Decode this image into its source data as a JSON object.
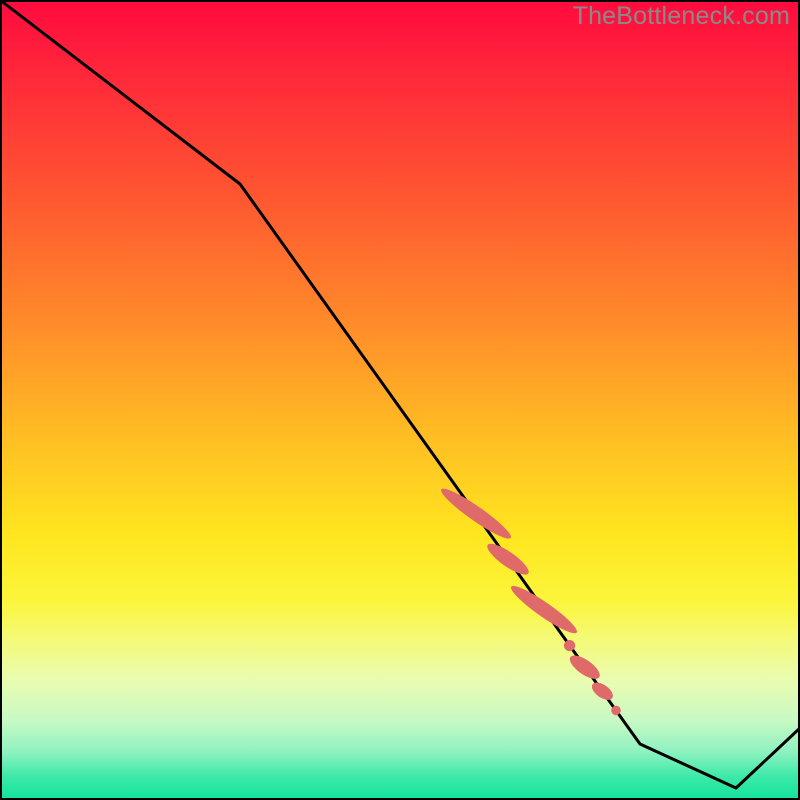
{
  "watermark": "TheBottleneck.com",
  "colors": {
    "line": "#000000",
    "marker": "#e06a6a",
    "gradient_top": "#ff0a3e",
    "gradient_bottom": "#11e39b"
  },
  "chart_data": {
    "type": "line",
    "title": "",
    "xlabel": "",
    "ylabel": "",
    "xlim": [
      0,
      100
    ],
    "ylim": [
      0,
      100
    ],
    "grid": false,
    "legend": false,
    "series": [
      {
        "name": "curve",
        "x": [
          0,
          30,
          80,
          92,
          100
        ],
        "y": [
          100,
          77,
          7,
          1.5,
          9
        ],
        "note": "y read as percentage of plot height from bottom; values estimated from pixel positions"
      }
    ],
    "markers": {
      "name": "points-on-line",
      "note": "salmon-colored dot/segment markers laid along the descending line, clustered ~x=58..78",
      "groups": [
        {
          "cx": 59.5,
          "cy": 35.8,
          "rx": 0.9,
          "ry": 5.3,
          "angle": -55
        },
        {
          "cx": 63.5,
          "cy": 30.1,
          "rx": 0.9,
          "ry": 3.1,
          "angle": -55
        },
        {
          "cx": 68.0,
          "cy": 23.8,
          "rx": 0.9,
          "ry": 5.0,
          "angle": -55
        },
        {
          "cx": 71.2,
          "cy": 19.3,
          "rx": 0.7,
          "ry": 0.7,
          "angle": 0
        },
        {
          "cx": 73.1,
          "cy": 16.6,
          "rx": 0.9,
          "ry": 2.2,
          "angle": -55
        },
        {
          "cx": 75.3,
          "cy": 13.6,
          "rx": 0.8,
          "ry": 1.5,
          "angle": -55
        },
        {
          "cx": 77.0,
          "cy": 11.2,
          "rx": 0.6,
          "ry": 0.6,
          "angle": 0
        }
      ]
    }
  }
}
